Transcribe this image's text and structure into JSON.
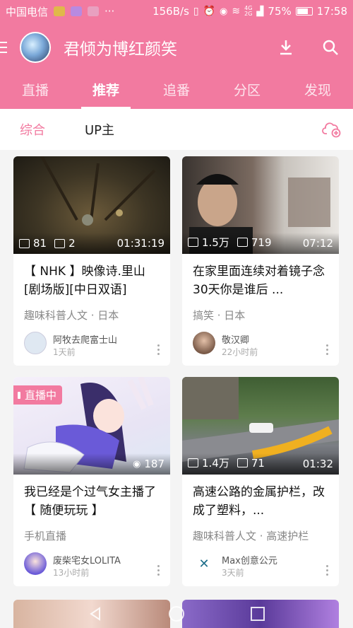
{
  "status_bar": {
    "carrier": "中国电信",
    "dots": "···",
    "speed": "156B/s",
    "signal_tag_top": "4G",
    "signal_tag_bottom": "2G",
    "battery": "75%",
    "time": "17:58"
  },
  "header": {
    "title": "君倾为博红颜笑"
  },
  "tabs": [
    {
      "label": "直播",
      "active": false
    },
    {
      "label": "推荐",
      "active": true
    },
    {
      "label": "追番",
      "active": false
    },
    {
      "label": "分区",
      "active": false
    },
    {
      "label": "发现",
      "active": false
    }
  ],
  "sub_filter": {
    "items": [
      {
        "label": "综合",
        "active": true
      },
      {
        "label": "UP主",
        "active": false
      }
    ]
  },
  "cards": [
    {
      "views": "81",
      "danmaku": "2",
      "duration": "01:31:19",
      "title": "【 NHK 】映像诗.里山[剧场版][中日双语]",
      "category": "趣味科普人文 · 日本",
      "author": "阿牧去爬富士山",
      "time": "1天前"
    },
    {
      "views": "1.5万",
      "danmaku": "719",
      "duration": "07:12",
      "title": "在家里面连续对着镜子念30天你是谁后 ...",
      "category": "搞笑 · 日本",
      "author": "敬汉卿",
      "time": "22小时前"
    },
    {
      "badge": "直播中",
      "viewers": "187",
      "title": "我已经是个过气女主播了【 随便玩玩 】",
      "category": "手机直播",
      "author": "废柴宅女LOLITA",
      "time": "13小时前"
    },
    {
      "views": "1.4万",
      "danmaku": "71",
      "duration": "01:32",
      "title": "高速公路的金属护栏，改成了塑料，...",
      "category": "趣味科普人文 · 高速护栏",
      "author": "Max创意公元",
      "time": "3天前"
    }
  ],
  "colors": {
    "brand": "#f27aa0",
    "background": "#f4f4f4"
  },
  "icons": {
    "header": [
      "menu-icon",
      "download-icon",
      "search-icon"
    ],
    "subbar": [
      "add-cloud-icon"
    ],
    "nav": [
      "back-icon",
      "home-icon",
      "recents-icon"
    ]
  }
}
